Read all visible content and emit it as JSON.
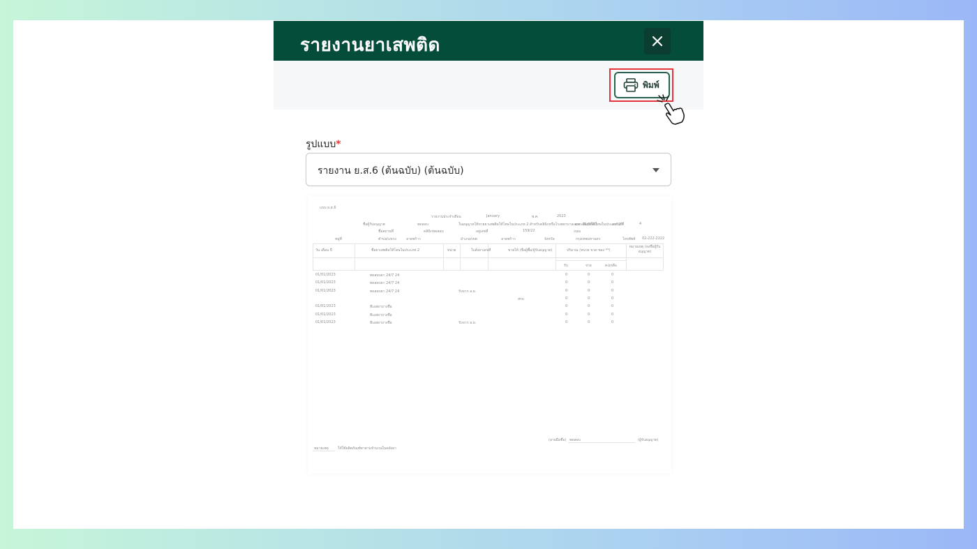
{
  "modal": {
    "title": "รายงานยาเสพติด",
    "close_icon": "close-icon",
    "print_label": "พิมพ์",
    "print_icon": "printer-icon",
    "cursor_icon": "hand-pointer-icon"
  },
  "form": {
    "format_label": "รูปแบบ",
    "required_mark": "*",
    "format_value": "รายงาน ย.ส.6 (ต้นฉบับ) (ต้นฉบับ)"
  },
  "preview": {
    "form_code": "แบบ ย.ส.6",
    "month_label": "รายงานประจำเดือน",
    "month_value": "January",
    "year_label": "พ.ศ.",
    "year_value": "2023",
    "row1_label_a": "ชื่อผู้รับอนุญาต",
    "row1_value_a": "ทดสอบ",
    "row1_text": "ในอนุญาตให้ขายยาเสพติดให้โทษในประเภท 2 สำหรับคลินิกหรือโรงพยาบาลเฉพาะพิเศษให้โทษในประเภท 2 ที่",
    "row1_value_b": "ย.ส. 01/2563",
    "row1_label_c": "ลงวันที่",
    "row1_value_c": "4",
    "row2_label_a": "ชื่อสถานที่",
    "row2_value_a": "คลินิกทดสอบ",
    "row2_label_b": "อยู่เลขที่",
    "row2_value_b": "159/22",
    "row2_label_c": "ถนน",
    "row3_label_a": "หมู่ที่",
    "row3_label_b": "ตำบล/แขวง",
    "row3_value_b": "ลาดพร้าว",
    "row3_label_c": "อำเภอ/เขต",
    "row3_value_c": "ลาดพร้าว",
    "row3_label_d": "จังหวัด",
    "row3_value_d": "กรุงเทพมหานคร",
    "row3_label_e": "โทรศัพท์",
    "row3_value_e": "02-222-2222",
    "headers": [
      "วัน เดือน ปี",
      "ชื่อยาเสพติดให้โทษในประเภท 2",
      "หน่วย",
      "ใบสั่งยาเลขที่",
      "ขายให้ (ชื่อผู้ซื้อ/ผู้รับอนุญาต)",
      "ปริมาณ (หน่วย ขวด ซอง **)",
      "หมายเหตุ (ลงชื่อผู้รับอนุญาต)"
    ],
    "qty_subheaders": [
      "รับ",
      "จ่าย",
      "คงเหลือ"
    ],
    "rows": [
      {
        "date": "01/01/2023",
        "drug": "ทดสอบยา 24/7 24",
        "rx": "",
        "buyer": "",
        "in": "0",
        "out": "0",
        "bal": "0"
      },
      {
        "date": "01/01/2023",
        "drug": "ทดสอบยา 24/7 24",
        "rx": "",
        "buyer": "",
        "in": "0",
        "out": "0",
        "bal": "0"
      },
      {
        "date": "01/01/2023",
        "drug": "ทดสอบยา 24/7 24",
        "rx": "รับจาก อ.ย.",
        "buyer": "",
        "in": "0",
        "out": "0",
        "bal": "0"
      },
      {
        "date": "",
        "drug": "",
        "rx": "",
        "buyer": "สรบ",
        "in": "0",
        "out": "0",
        "bal": "0"
      },
      {
        "date": "01/01/2023",
        "drug": "ทีเอสยาบางชื่อ",
        "rx": "",
        "buyer": "",
        "in": "0",
        "out": "0",
        "bal": "0"
      },
      {
        "date": "01/01/2023",
        "drug": "ทีเอสยาบางชื่อ",
        "rx": "",
        "buyer": "",
        "in": "0",
        "out": "0",
        "bal": "0"
      },
      {
        "date": "01/01/2023",
        "drug": "ทีเอสยาบางชื่อ",
        "rx": "รับจาก อ.ย.",
        "buyer": "",
        "in": "0",
        "out": "0",
        "bal": "0"
      }
    ],
    "sign_label": "(ลายมือชื่อ)",
    "sign_value": "ทดสอบ",
    "sign_role": "(ผู้รับอนุญาต)",
    "footer_label": "หมายเหตุ",
    "footer_text": "ให้ใช้ผลิตภัณฑ์ยาตามจำนวนในคลังยา"
  },
  "colors": {
    "header_bg": "#054d3b",
    "highlight": "#e8333c",
    "required": "#e53935"
  }
}
